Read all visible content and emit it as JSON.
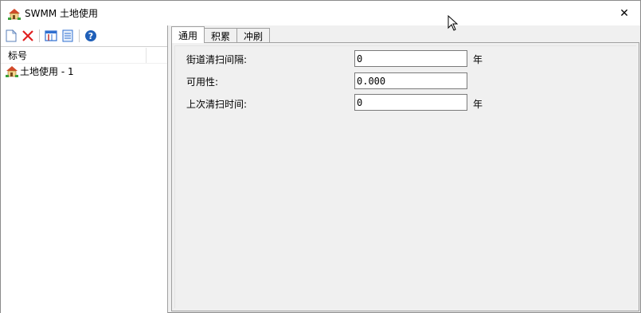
{
  "window": {
    "title": "SWMM 土地使用",
    "close_glyph": "✕"
  },
  "toolbar": {
    "buttons": [
      {
        "icon": "new-document-icon"
      },
      {
        "icon": "delete-icon"
      },
      {
        "icon": "properties-icon"
      },
      {
        "icon": "report-icon"
      },
      {
        "icon": "help-icon"
      }
    ]
  },
  "list": {
    "header": "标号",
    "items": [
      {
        "label": "土地使用 - 1",
        "icon": "landuse-icon"
      }
    ]
  },
  "tabs": [
    {
      "label": "通用",
      "active": true
    },
    {
      "label": "积累",
      "active": false
    },
    {
      "label": "冲刷",
      "active": false
    }
  ],
  "fields": [
    {
      "label": "街道清扫间隔:",
      "value": "0",
      "unit": "年"
    },
    {
      "label": "可用性:",
      "value": "0.000",
      "unit": ""
    },
    {
      "label": "上次清扫时间:",
      "value": "0",
      "unit": "年"
    }
  ],
  "colors": {
    "delete_red": "#e02020",
    "help_blue": "#1f5fb8",
    "doc_blue": "#2f6fd0"
  }
}
